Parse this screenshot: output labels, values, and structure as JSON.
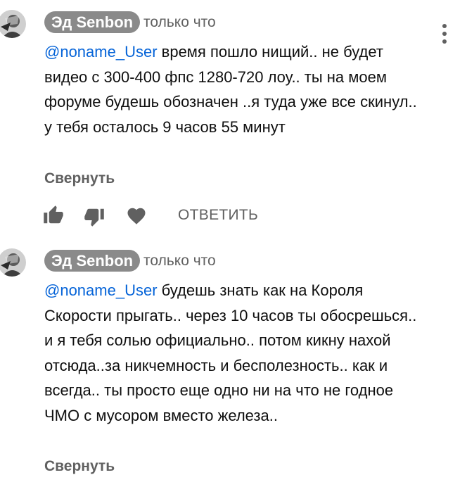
{
  "comments": [
    {
      "author": "Эд Senbon",
      "time": "только что",
      "mention": "@noname_User",
      "text": " время пошло нищий.. не будет видео с 300-400 фпс 1280-720 лоу.. ты на моем форуме будешь обозначен ..я туда уже все скинул.. у тебя осталось 9 часов 55 минут",
      "collapse": "Свернуть",
      "reply": "ОТВЕТИТЬ"
    },
    {
      "author": "Эд Senbon",
      "time": "только что",
      "mention": "@noname_User",
      "text": " будешь знать как на Короля Скорости прыгать.. через 10 часов ты обосрешься.. и я тебя солью официально.. потом кикну нахой отсюда..за никчемность и бесполезность.. как и всегда.. ты просто еще одно ни на что не годное ЧМО с мусором вместо железа..",
      "collapse": "Свернуть"
    }
  ],
  "icons": {
    "like": "thumbs-up-icon",
    "dislike": "thumbs-down-icon",
    "heart": "heart-icon",
    "menu": "more-vertical-icon"
  },
  "colors": {
    "mention": "#0664d8",
    "author_chip": "#8a8a8a",
    "secondary_text": "#606060"
  }
}
